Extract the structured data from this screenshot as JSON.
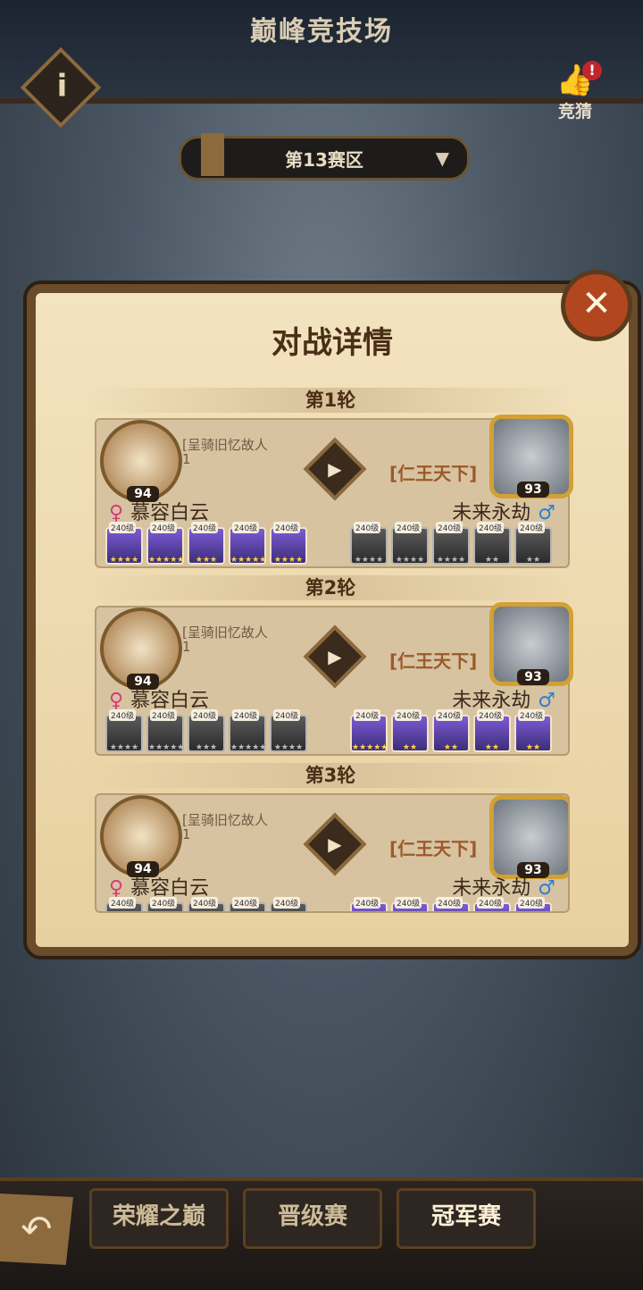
{
  "header": {
    "title": "巅峰竞技场",
    "guess_label": "竞猜",
    "badge": "!"
  },
  "zone": {
    "label": "第13赛区"
  },
  "panel": {
    "title": "对战详情"
  },
  "rounds": [
    {
      "label": "第1轮",
      "left_level": "94",
      "left_record_name": "[呈骑旧忆故人",
      "left_record_sub": "1",
      "left_player": "慕容白云",
      "right_record": "[仁王天下]",
      "right_level": "93",
      "right_player": "未来永劫"
    },
    {
      "label": "第2轮",
      "left_level": "94",
      "left_record_name": "[呈骑旧忆故人",
      "left_record_sub": "1",
      "left_player": "慕容白云",
      "right_record": "[仁王天下]",
      "right_level": "93",
      "right_player": "未来永劫"
    },
    {
      "label": "第3轮",
      "left_level": "94",
      "left_record_name": "[呈骑旧忆故人",
      "left_record_sub": "1",
      "left_player": "慕容白云",
      "right_record": "[仁王天下]",
      "right_level": "93",
      "right_player": "未来永劫"
    }
  ],
  "hero_level": "240级",
  "gender_female": "♀",
  "gender_male": "♂",
  "play_icon": "▶",
  "close_icon": "✕",
  "info_icon": "i",
  "back_icon": "↶",
  "bottom_tabs": [
    "荣耀之巅",
    "晋级赛",
    "冠军赛"
  ]
}
